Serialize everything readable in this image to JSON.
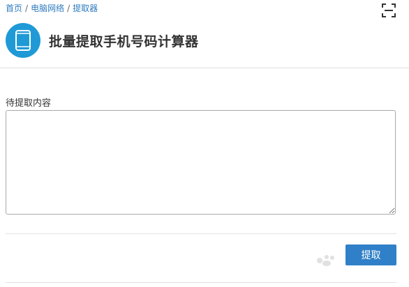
{
  "breadcrumb": {
    "items": [
      {
        "label": "首页"
      },
      {
        "label": "电脑网络"
      },
      {
        "label": "提取器"
      }
    ],
    "separator": "/"
  },
  "header": {
    "title": "批量提取手机号码计算器",
    "icon": "tablet-icon",
    "icon_bg_color": "#1f9ad7"
  },
  "toolbar": {
    "scan_icon": "scan-icon"
  },
  "form": {
    "content_label": "待提取内容",
    "content_value": "",
    "content_placeholder": ""
  },
  "actions": {
    "extract_label": "提取",
    "button_color": "#2f80c8"
  },
  "watermark": {
    "text": "Baidu"
  }
}
